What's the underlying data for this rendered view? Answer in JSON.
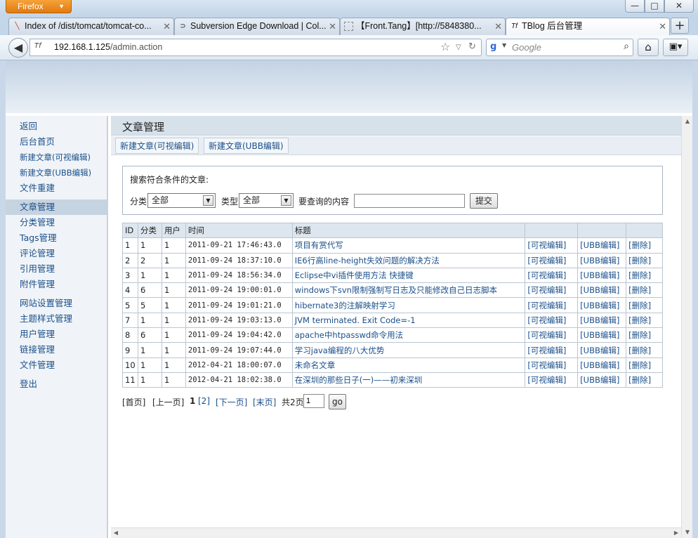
{
  "browser": {
    "app_button": "Firefox",
    "window_controls": {
      "minimize": "—",
      "maximize": "□",
      "close": "✕"
    },
    "tabs": [
      {
        "label": "Index of /dist/tomcat/tomcat-co...",
        "icon": "feather-icon",
        "active": false
      },
      {
        "label": "Subversion Edge Download | Col...",
        "icon": "collabnet-icon",
        "active": false
      },
      {
        "label": "【Front.Tang】[http://5848380...",
        "icon": "blank-page-icon",
        "active": false
      },
      {
        "label": "TBlog 后台管理",
        "icon": "tf-site-icon",
        "active": true
      }
    ],
    "new_tab": "+",
    "url_host": "192.168.1.125",
    "url_path": "/admin.action",
    "site_icon_text": "Tf",
    "search_placeholder": "Google",
    "search_engine_letter": "g"
  },
  "sidebar": {
    "groups": [
      [
        {
          "label": "返回",
          "small": false
        },
        {
          "label": "后台首页",
          "small": false
        },
        {
          "label": "新建文章(可视编辑)",
          "small": true
        },
        {
          "label": "新建文章(UBB编辑)",
          "small": true
        },
        {
          "label": "文件重建",
          "small": false
        }
      ],
      [
        {
          "label": "文章管理",
          "small": false,
          "active": true
        },
        {
          "label": "分类管理",
          "small": false
        },
        {
          "label": "Tags管理",
          "small": false
        },
        {
          "label": "评论管理",
          "small": false
        },
        {
          "label": "引用管理",
          "small": false
        },
        {
          "label": "附件管理",
          "small": false
        }
      ],
      [
        {
          "label": "网站设置管理",
          "small": false
        },
        {
          "label": "主题样式管理",
          "small": false
        },
        {
          "label": "用户管理",
          "small": false
        },
        {
          "label": "链接管理",
          "small": false
        },
        {
          "label": "文件管理",
          "small": false
        }
      ],
      [
        {
          "label": "登出",
          "small": false
        }
      ]
    ]
  },
  "main": {
    "title": "文章管理",
    "subtabs": [
      "新建文章(可视编辑)",
      "新建文章(UBB编辑)"
    ],
    "search": {
      "heading": "搜索符合条件的文章:",
      "category_label": "分类",
      "category_value": "全部",
      "type_label": "类型",
      "type_value": "全部",
      "query_label": "要查询的内容",
      "query_value": "",
      "submit": "提交"
    },
    "table": {
      "headers": [
        "ID",
        "分类",
        "用户",
        "时间",
        "标题",
        "",
        "",
        ""
      ],
      "action_labels": [
        "[可视编辑]",
        "[UBB编辑]",
        "[删除]"
      ],
      "rows": [
        {
          "id": "1",
          "cat": "1",
          "user": "1",
          "time": "2011-09-21 17:46:43.0",
          "title": "项目有赏代写"
        },
        {
          "id": "2",
          "cat": "2",
          "user": "1",
          "time": "2011-09-24 18:37:10.0",
          "title": "IE6行高line-height失效问题的解决方法"
        },
        {
          "id": "3",
          "cat": "1",
          "user": "1",
          "time": "2011-09-24 18:56:34.0",
          "title": "Eclipse中vi插件使用方法 快捷键"
        },
        {
          "id": "4",
          "cat": "6",
          "user": "1",
          "time": "2011-09-24 19:00:01.0",
          "title": "windows下svn限制强制写日志及只能修改自己日志脚本"
        },
        {
          "id": "5",
          "cat": "5",
          "user": "1",
          "time": "2011-09-24 19:01:21.0",
          "title": "hibernate3的注解映射学习"
        },
        {
          "id": "7",
          "cat": "1",
          "user": "1",
          "time": "2011-09-24 19:03:13.0",
          "title": "JVM terminated. Exit Code=-1"
        },
        {
          "id": "8",
          "cat": "6",
          "user": "1",
          "time": "2011-09-24 19:04:42.0",
          "title": "apache中htpasswd命令用法"
        },
        {
          "id": "9",
          "cat": "1",
          "user": "1",
          "time": "2011-09-24 19:07:44.0",
          "title": "学习java编程的八大优势"
        },
        {
          "id": "10",
          "cat": "1",
          "user": "1",
          "time": "2012-04-21 18:00:07.0",
          "title": "未命名文章"
        },
        {
          "id": "11",
          "cat": "1",
          "user": "1",
          "time": "2012-04-21 18:02:38.0",
          "title": "在深圳的那些日子(一)——初来深圳"
        }
      ]
    },
    "pager": {
      "first": "[首页]",
      "prev": "[上一页]",
      "current": "1",
      "page2": "[2]",
      "next": "[下一页]",
      "last": "[末页]",
      "total": "共2页",
      "jump_value": "1",
      "go": "go"
    }
  }
}
